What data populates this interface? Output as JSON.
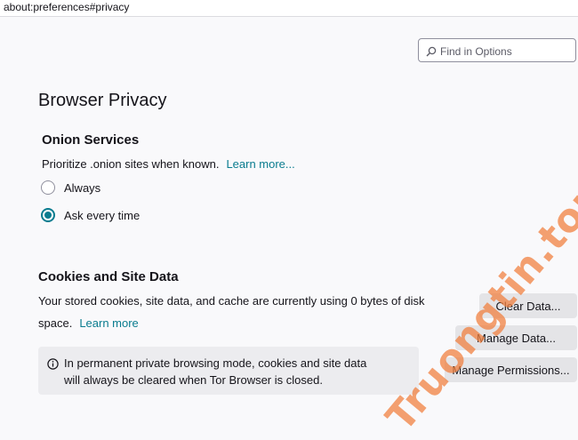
{
  "urlbar": {
    "url": "about:preferences#privacy"
  },
  "search": {
    "placeholder": "Find in Options"
  },
  "page": {
    "title": "Browser Privacy"
  },
  "onion": {
    "heading": "Onion Services",
    "description": "Prioritize .onion sites when known.",
    "learn_more": "Learn more...",
    "options": [
      {
        "label": "Always",
        "checked": false
      },
      {
        "label": "Ask every time",
        "checked": true
      }
    ]
  },
  "cookies": {
    "heading": "Cookies and Site Data",
    "description_line1": "Your stored cookies, site data, and cache are currently using 0 bytes of disk",
    "description_line2": "space.",
    "learn_more": "Learn more",
    "buttons": {
      "clear": "Clear Data...",
      "manage": "Manage Data...",
      "permissions": "Manage Permissions..."
    },
    "info_line1": "In permanent private browsing mode, cookies and site data",
    "info_line2": "will always be cleared when Tor Browser is closed."
  },
  "watermark": {
    "text": "Truongtin.top"
  },
  "colors": {
    "accent": "#0a7c8f",
    "watermark": "#f08040",
    "button_bg": "#e4e4e7"
  },
  "icons": {
    "search": "search-icon",
    "info": "info-icon"
  }
}
